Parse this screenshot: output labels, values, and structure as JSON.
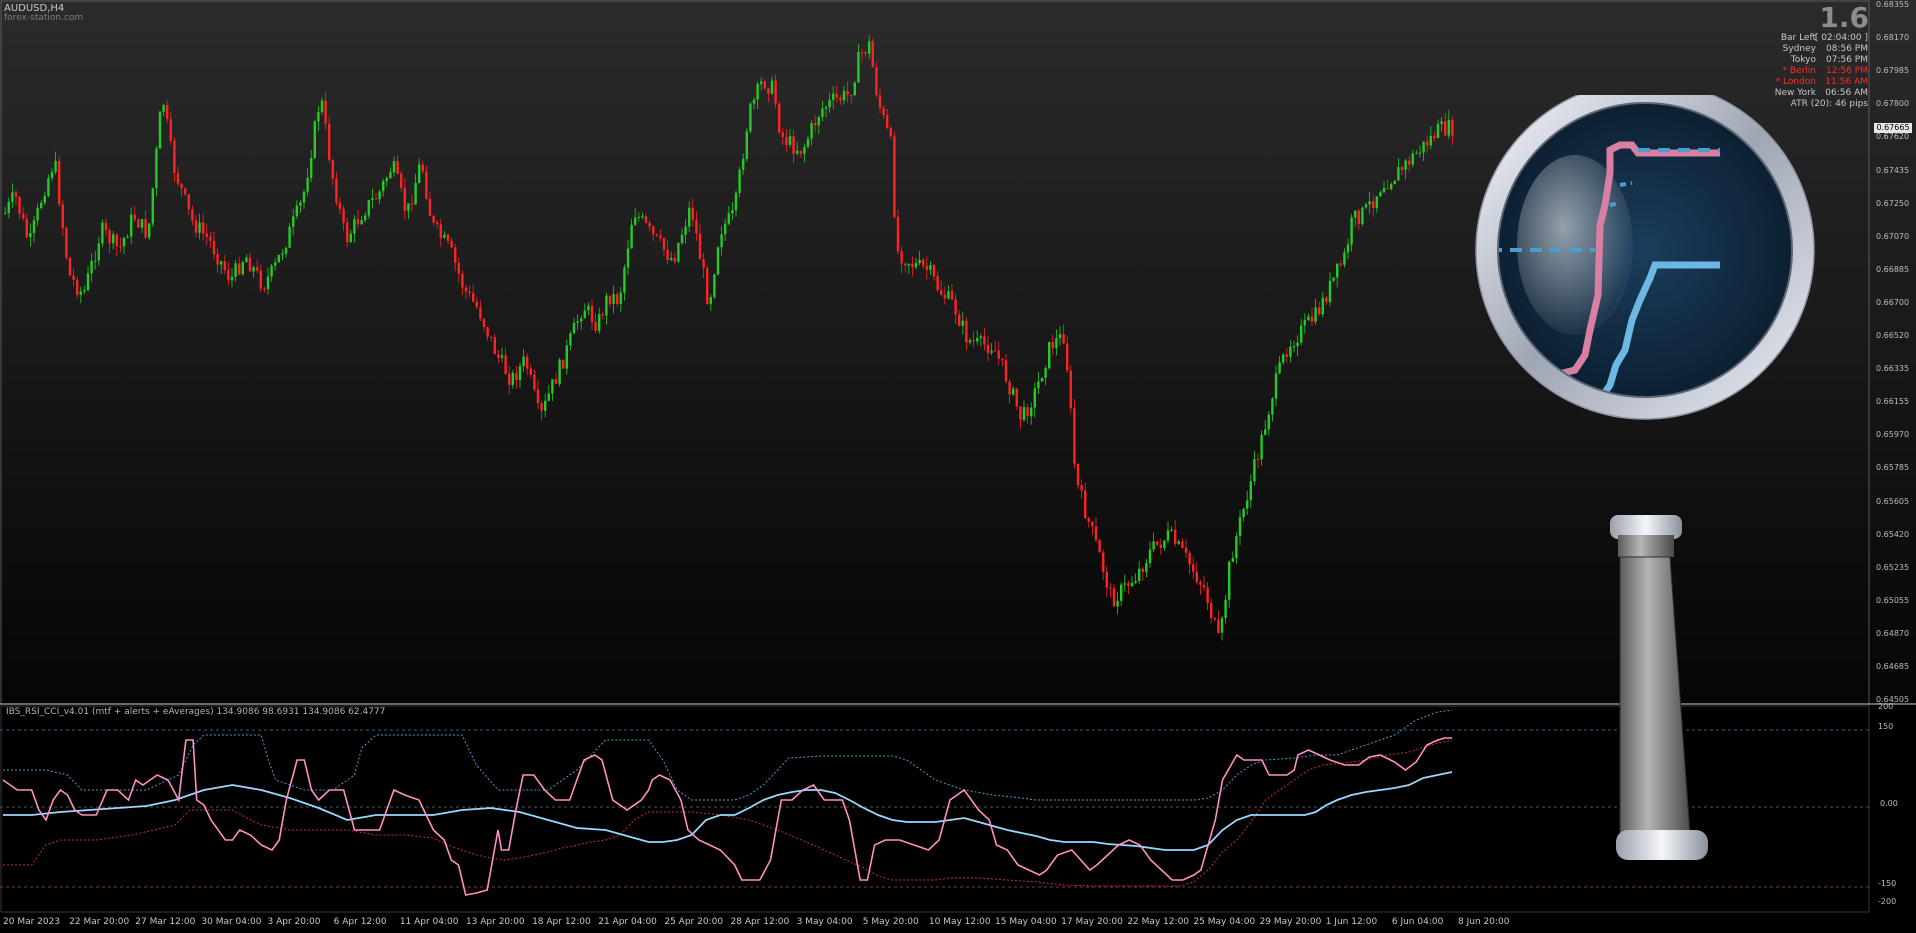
{
  "window": {
    "symbol": "AUDUSD,H4",
    "watermark": "forex-station.com",
    "big_number": "1.6"
  },
  "session_info": [
    {
      "label": "Bar Left",
      "value": "[ 02:04:00 ]",
      "color": "#c8c8c8"
    },
    {
      "label": "Sydney",
      "value": "08:56 PM",
      "color": "#c8c8c8"
    },
    {
      "label": "Tokyo",
      "value": "07:56 PM",
      "color": "#c8c8c8"
    },
    {
      "label": "* Berlin",
      "value": "12:56 PM",
      "color": "#ff2a2a"
    },
    {
      "label": "* London",
      "value": "11:56 AM",
      "color": "#ff2a2a"
    },
    {
      "label": "New York",
      "value": "06:56 AM",
      "color": "#c8c8c8"
    }
  ],
  "atr_text": "ATR (20): 46 pips",
  "current_price": "0.67665",
  "price_axis": [
    "0.68355",
    "0.68170",
    "0.67985",
    "0.67800",
    "0.67620",
    "0.67435",
    "0.67250",
    "0.67070",
    "0.66885",
    "0.66700",
    "0.66520",
    "0.66335",
    "0.66155",
    "0.65970",
    "0.65785",
    "0.65605",
    "0.65420",
    "0.65235",
    "0.65055",
    "0.64870",
    "0.64685",
    "0.64505"
  ],
  "indicator": {
    "title": "IBS_RSI_CCI_v4.01 (mtf + alerts + eAverages) 134.9086 98.6931 134.9086 62.4777",
    "levels": [
      "200",
      "150",
      "0.00",
      "-150",
      "-200"
    ]
  },
  "time_axis": [
    "20 Mar 2023",
    "22 Mar 20:00",
    "27 Mar 12:00",
    "30 Mar 04:00",
    "3 Apr 20:00",
    "6 Apr 12:00",
    "11 Apr 04:00",
    "13 Apr 20:00",
    "18 Apr 12:00",
    "21 Apr 04:00",
    "25 Apr 20:00",
    "28 Apr 12:00",
    "3 May 04:00",
    "5 May 20:00",
    "10 May 12:00",
    "15 May 04:00",
    "17 May 20:00",
    "22 May 12:00",
    "25 May 04:00",
    "29 May 20:00",
    "1 Jun 12:00",
    "6 Jun 04:00",
    "8 Jun 20:00"
  ],
  "colors": {
    "bull": "#22cc22",
    "bear": "#ff2222",
    "ibs_line": "#ff8fc4",
    "rsi_line": "#9ad8ff",
    "upper_band": "#4a9fd0",
    "lower_band": "#c23040"
  },
  "magnifier_icon": "magnifying-glass-icon"
}
